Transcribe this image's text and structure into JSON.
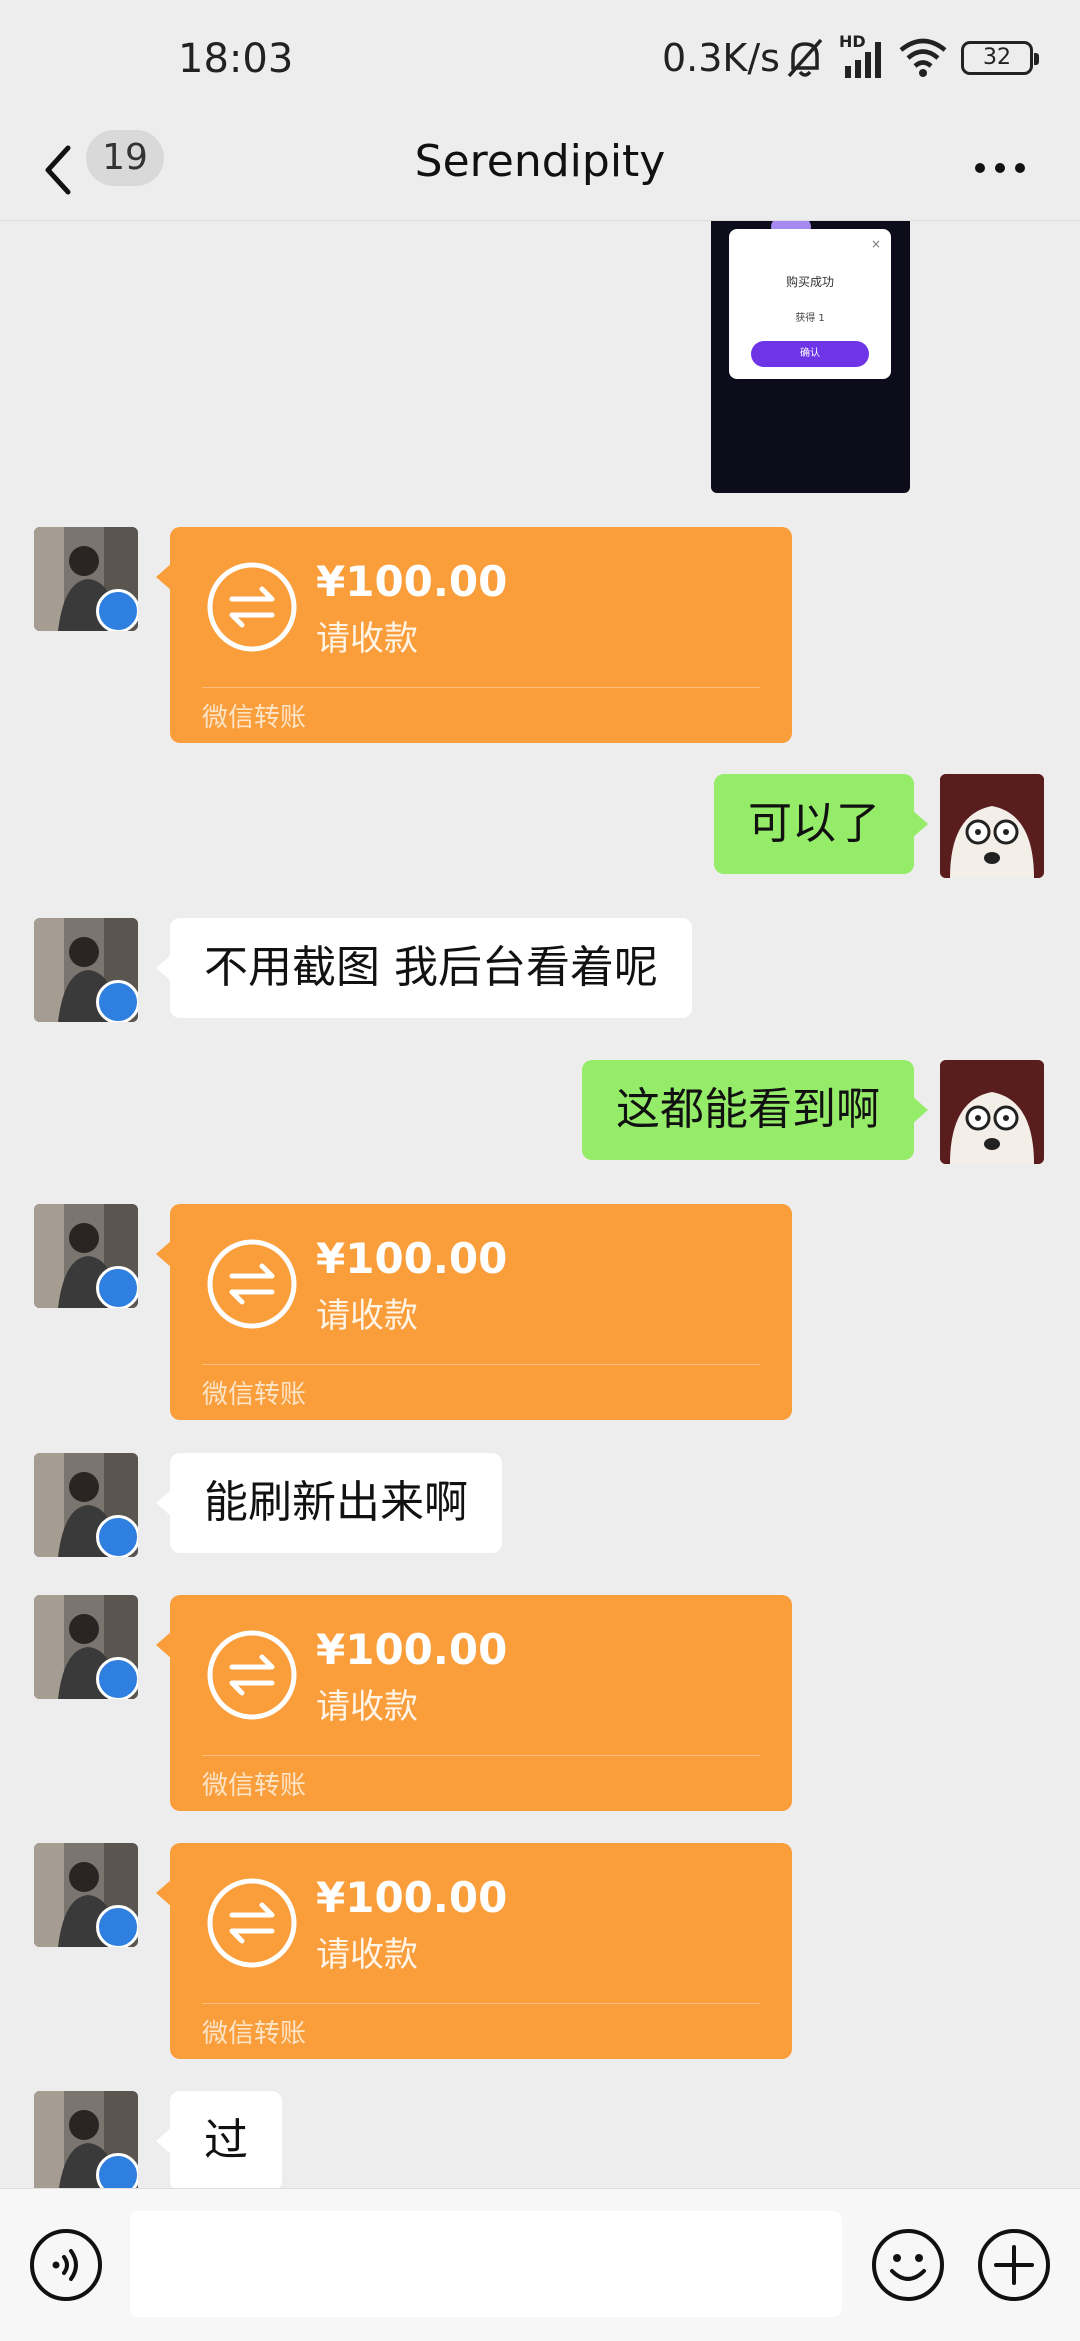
{
  "status_bar": {
    "time": "18:03",
    "net_speed": "0.3K/s",
    "network_type": "HD",
    "battery": "32",
    "icons": [
      "mute-bell-icon",
      "signal-icon",
      "wifi-icon",
      "battery-icon"
    ]
  },
  "nav": {
    "back_icon": "chevron-left-icon",
    "unread_count": "19",
    "title": "Serendipity",
    "more_icon": "more-dots-icon"
  },
  "screenshot_preview": {
    "title": "购买成功",
    "text": "获得 1",
    "button": "确认"
  },
  "messages": [
    {
      "type": "transfer",
      "side": "in",
      "amount": "¥100.00",
      "status": "请收款",
      "footer": "微信转账"
    },
    {
      "type": "text",
      "side": "out",
      "text": "可以了"
    },
    {
      "type": "text",
      "side": "in",
      "text": "不用截图 我后台看着呢"
    },
    {
      "type": "text",
      "side": "out",
      "text": "这都能看到啊"
    },
    {
      "type": "transfer",
      "side": "in",
      "amount": "¥100.00",
      "status": "请收款",
      "footer": "微信转账"
    },
    {
      "type": "text",
      "side": "in",
      "text": "能刷新出来啊"
    },
    {
      "type": "transfer",
      "side": "in",
      "amount": "¥100.00",
      "status": "请收款",
      "footer": "微信转账"
    },
    {
      "type": "transfer",
      "side": "in",
      "amount": "¥100.00",
      "status": "请收款",
      "footer": "微信转账"
    },
    {
      "type": "text",
      "side": "in",
      "text": "过"
    }
  ],
  "input_bar": {
    "voice_icon": "voice-icon",
    "input_value": "",
    "emoji_icon": "emoji-icon",
    "plus_icon": "plus-icon"
  },
  "colors": {
    "background": "#ededed",
    "incoming_bubble": "#ffffff",
    "outgoing_bubble": "#95ec69",
    "transfer_card": "#fa9d3b"
  }
}
